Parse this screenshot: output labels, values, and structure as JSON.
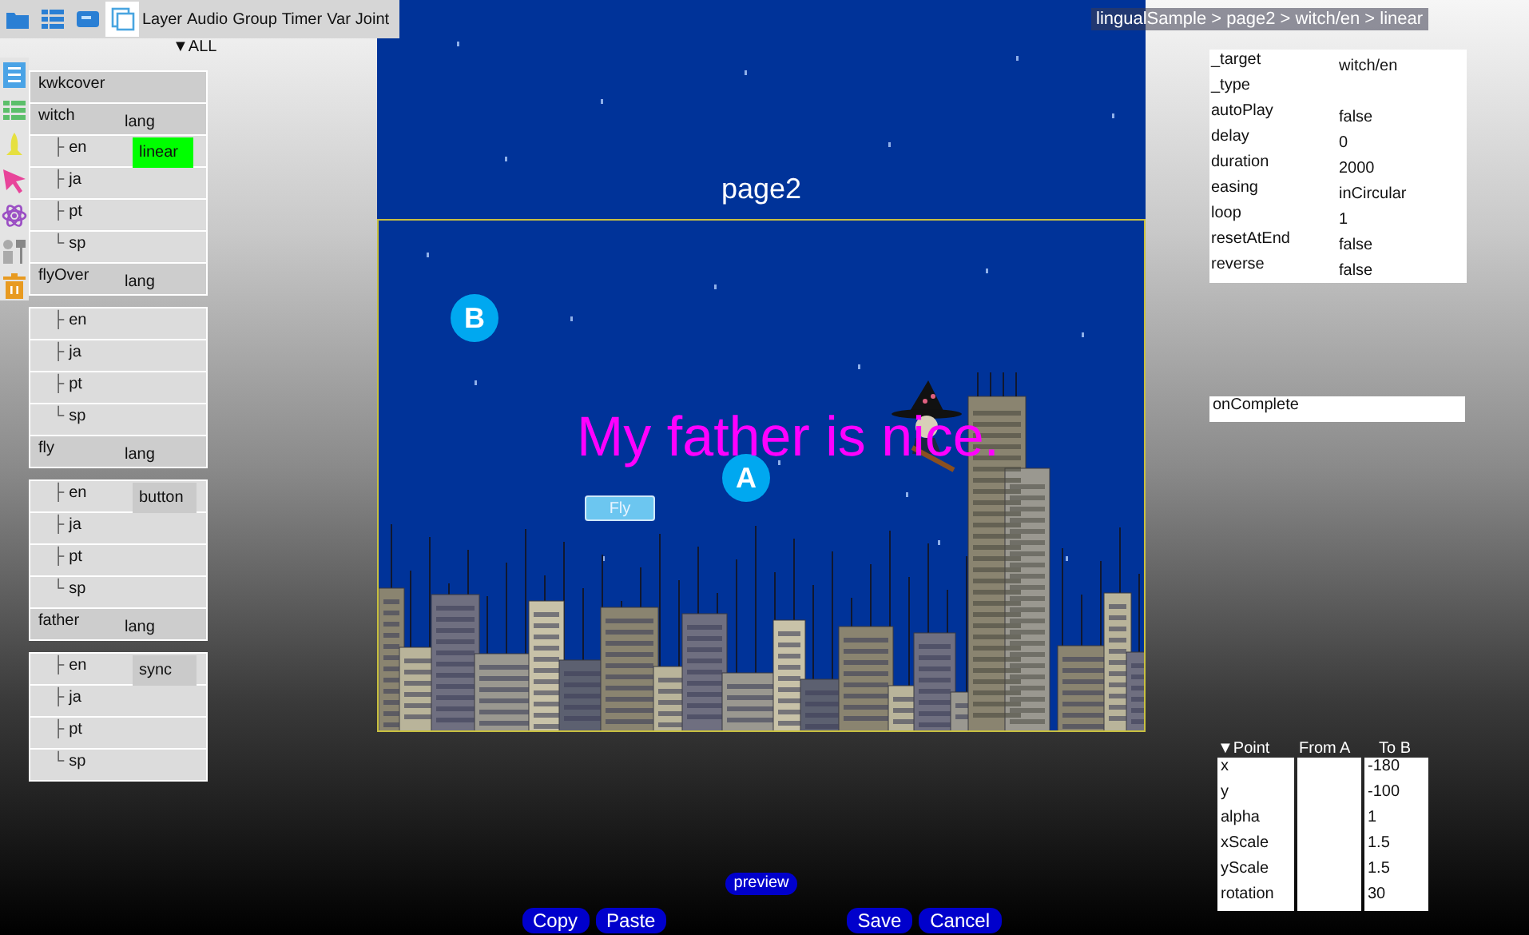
{
  "toolbar": {
    "icons": [
      {
        "kind": "folder",
        "selected": false
      },
      {
        "kind": "list",
        "selected": false
      },
      {
        "kind": "window",
        "selected": false
      },
      {
        "kind": "page",
        "selected": true
      }
    ],
    "tabs": [
      "Layer",
      "Audio",
      "Group",
      "Timer",
      "Var",
      "Joint"
    ]
  },
  "filter": {
    "arrow": "▼",
    "label": "ALL"
  },
  "layers": [
    {
      "rows": [
        {
          "kind": "object",
          "name": "kwkcover"
        },
        {
          "kind": "object",
          "name": "witch",
          "tag": "lang"
        },
        {
          "kind": "child",
          "branch": "├",
          "name": "en",
          "tag": "linear",
          "selected": true
        },
        {
          "kind": "child",
          "branch": "├",
          "name": "ja"
        },
        {
          "kind": "child",
          "branch": "├",
          "name": "pt"
        },
        {
          "kind": "child",
          "branch": "└",
          "name": "sp"
        },
        {
          "kind": "object",
          "name": "flyOver",
          "tag": "lang"
        }
      ]
    },
    {
      "rows": [
        {
          "kind": "child",
          "branch": "├",
          "name": "en"
        },
        {
          "kind": "child",
          "branch": "├",
          "name": "ja"
        },
        {
          "kind": "child",
          "branch": "├",
          "name": "pt"
        },
        {
          "kind": "child",
          "branch": "└",
          "name": "sp"
        },
        {
          "kind": "object",
          "name": "fly",
          "tag": "lang"
        }
      ]
    },
    {
      "rows": [
        {
          "kind": "child",
          "branch": "├",
          "name": "en",
          "tag": "button",
          "selected": false
        },
        {
          "kind": "child",
          "branch": "├",
          "name": "ja"
        },
        {
          "kind": "child",
          "branch": "├",
          "name": "pt"
        },
        {
          "kind": "child",
          "branch": "└",
          "name": "sp"
        },
        {
          "kind": "object",
          "name": "father",
          "tag": "lang"
        }
      ]
    },
    {
      "rows": [
        {
          "kind": "child",
          "branch": "├",
          "name": "en",
          "tag": "sync",
          "selected": false
        },
        {
          "kind": "child",
          "branch": "├",
          "name": "ja"
        },
        {
          "kind": "child",
          "branch": "├",
          "name": "pt"
        },
        {
          "kind": "child",
          "branch": "└",
          "name": "sp"
        }
      ]
    }
  ],
  "stage": {
    "page_title": "page2",
    "caption": "My father is nice.",
    "button": "Fly",
    "markers": [
      {
        "label": "B"
      },
      {
        "label": "A"
      }
    ]
  },
  "breadcrumb": "lingualSample > page2 > witch/en > linear",
  "properties": [
    {
      "name": "_target",
      "value": "witch/en"
    },
    {
      "name": "_type"
    },
    {
      "name": "autoPlay",
      "value": "false"
    },
    {
      "name": "delay",
      "value": "0"
    },
    {
      "name": "duration",
      "value": "2000"
    },
    {
      "name": "easing",
      "value": "inCircular"
    },
    {
      "name": "loop",
      "value": "1"
    },
    {
      "name": "resetAtEnd",
      "value": "false"
    },
    {
      "name": "reverse",
      "value": "false"
    }
  ],
  "event": "onComplete",
  "point_table": {
    "columns": [
      "▼Point",
      "From A",
      "To B"
    ],
    "rows": [
      {
        "name": "x",
        "to": "-180"
      },
      {
        "name": "y",
        "to": "-100"
      },
      {
        "name": "alpha",
        "to": "1"
      },
      {
        "name": "xScale",
        "to": "1.5"
      },
      {
        "name": "yScale",
        "to": "1.5"
      },
      {
        "name": "rotation",
        "to": "30"
      }
    ]
  },
  "preview_button": "preview",
  "buttons": [
    "Copy",
    "Paste",
    "Save",
    "Cancel"
  ]
}
